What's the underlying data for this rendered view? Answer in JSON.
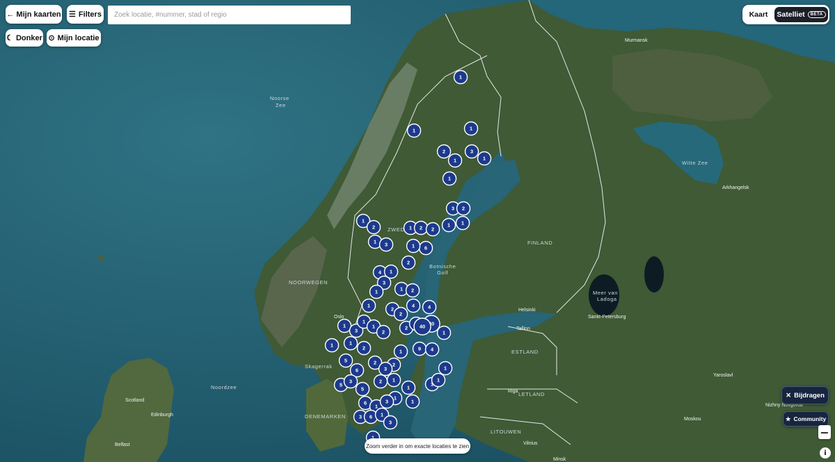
{
  "toolbar": {
    "back_label": "← Mijn kaarten",
    "filters_label": "Filters",
    "search_placeholder": "Zoek locatie, #nummer, stad of regio",
    "dark_label": "Donker",
    "location_label": "Mijn locatie"
  },
  "maptype": {
    "map_label": "Kaart",
    "satellite_label": "Satelliet",
    "beta_badge": "BETA"
  },
  "actions": {
    "contribute_label": "Bijdragen",
    "community_label": "Community",
    "zoom_out": "−",
    "info": "i"
  },
  "toast": "Zoom verder in om exacte locaties te zien",
  "labels": {
    "noorse_zee_1": "Noorse",
    "noorse_zee_2": "Zee",
    "witte_zee": "Witte Zee",
    "finland": "FINLAND",
    "noorwegen": "NOORWEGEN",
    "zweden": "ZWEDEN",
    "botnische_1": "Botnische",
    "botnische_2": "Golf",
    "noordzee": "Noordzee",
    "skagerrak": "Skagerrak",
    "denemarken": "DENEMARKEN",
    "estland": "ESTLAND",
    "letland": "LETLAND",
    "litouwen": "LITOUWEN",
    "ladoga_1": "Meer van",
    "ladoga_2": "Ladoga"
  },
  "cities": {
    "murmansk": "Murmansk",
    "arkhangelsk": "Arkhangelsk",
    "helsinki": "Helsinki",
    "tallinn": "Tallinn",
    "st_petersburg": "Sankt-Petersburg",
    "oslo": "Oslo",
    "scotland": "Scotland",
    "edinburgh": "Edinburgh",
    "belfast": "Belfast",
    "riga": "Riga",
    "vilnius": "Vilnius",
    "minsk": "Minsk",
    "moskou": "Moskou",
    "yaroslavl": "Yaroslavl",
    "nizhny": "Nizhny Novgorod"
  },
  "cluster_counts": [
    "1",
    "1",
    "1",
    "2",
    "1",
    "3",
    "1",
    "1",
    "3",
    "2",
    "1",
    "2",
    "1",
    "2",
    "2",
    "1",
    "1",
    "1",
    "3",
    "6",
    "1",
    "2",
    "4",
    "1",
    "3",
    "1",
    "1",
    "2",
    "1",
    "2",
    "4",
    "4",
    "2",
    "1",
    "3",
    "1",
    "1",
    "2",
    "2",
    "3",
    "40",
    "40",
    "1",
    "1",
    "1",
    "2",
    "1",
    "9",
    "4",
    "5",
    "6",
    "2",
    "2",
    "3",
    "1",
    "1",
    "5",
    "3",
    "5",
    "2",
    "1",
    "1",
    "1",
    "6",
    "1",
    "1",
    "3",
    "1",
    "3",
    "6",
    "1",
    "3",
    "1"
  ]
}
